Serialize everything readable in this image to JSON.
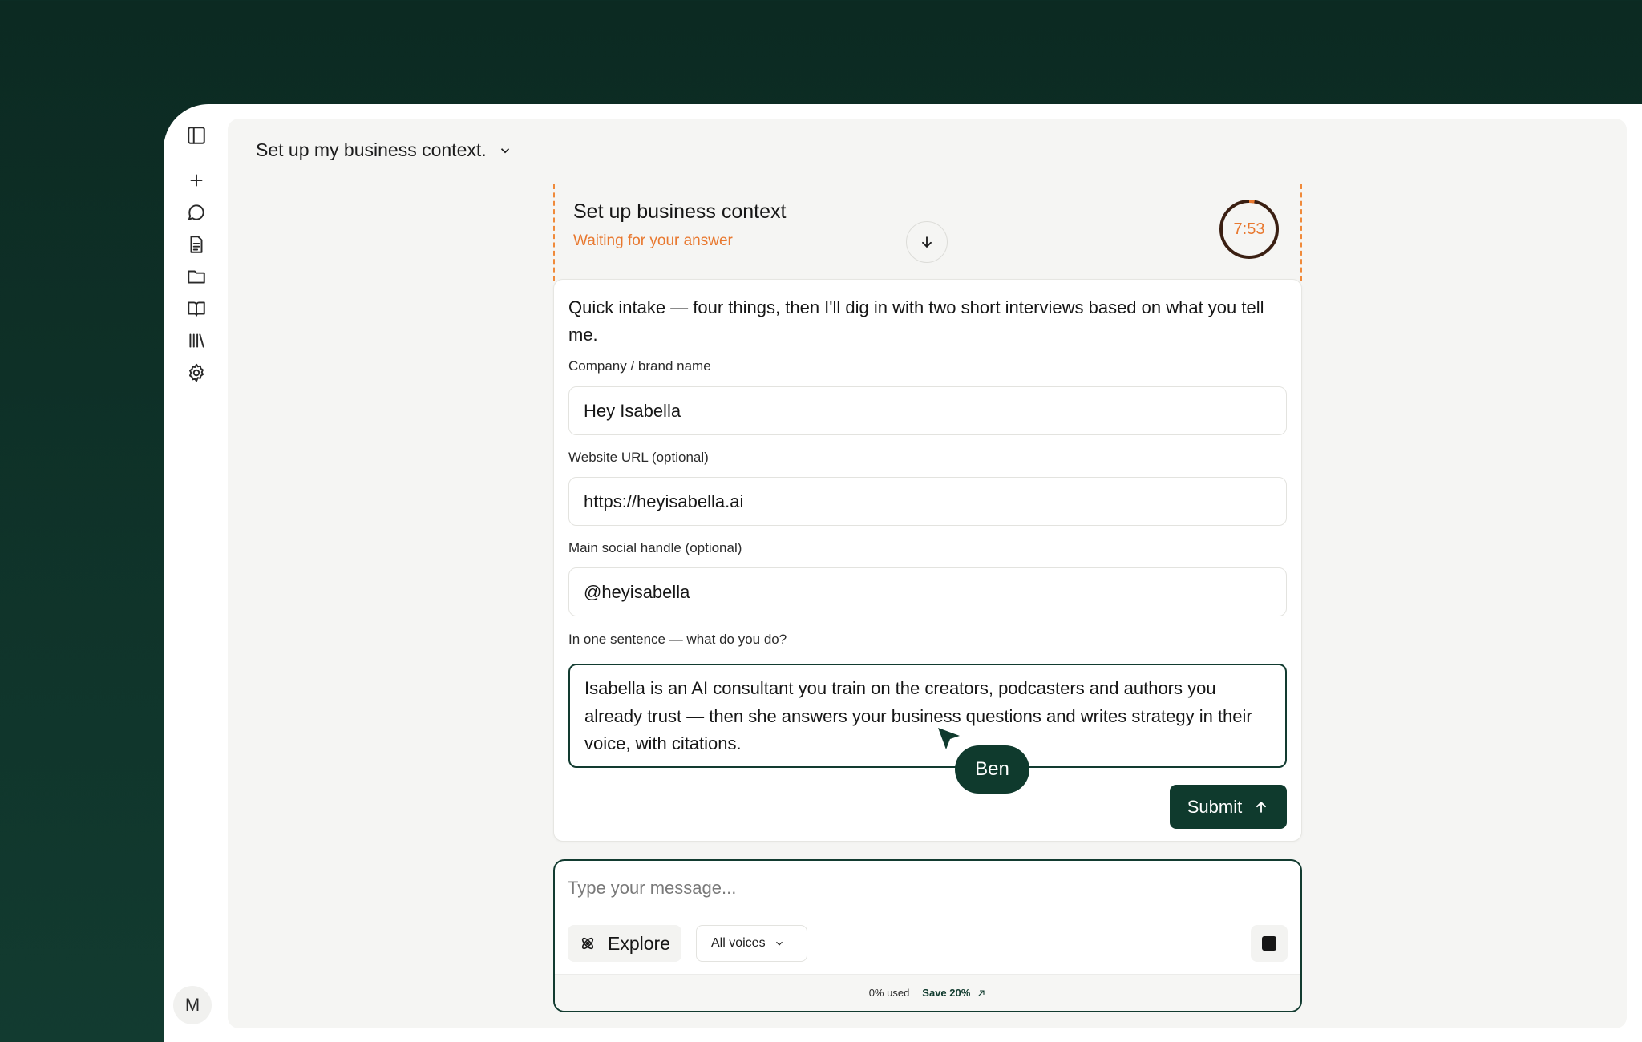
{
  "header": {
    "chat_title": "Set up my business context."
  },
  "task": {
    "title": "Set up business context",
    "status": "Waiting for your answer",
    "timer": "7:53",
    "timer_progress": 0.03,
    "status_color": "#e8782f"
  },
  "form": {
    "intro": "Quick intake — four things, then I'll dig in with two short interviews based on what you tell me.",
    "fields": [
      {
        "label": "Company / brand name",
        "value": "Hey Isabella"
      },
      {
        "label": "Website URL (optional)",
        "value": "https://heyisabella.ai"
      },
      {
        "label": "Main social handle (optional)",
        "value": "@heyisabella"
      },
      {
        "label": "In one sentence — what do you do?",
        "value": "Isabella is an AI consultant you train on the creators, podcasters and authors you already trust — then she answers your business questions and writes strategy in their voice, with citations."
      }
    ],
    "submit_label": "Submit"
  },
  "cursor": {
    "name": "Ben"
  },
  "composer": {
    "placeholder": "Type your message...",
    "explore_label": "Explore",
    "voices_label": "All voices",
    "usage_text": "0% used",
    "save_label": "Save 20%"
  },
  "sidebar": {
    "icons": [
      "sidebar-toggle-icon",
      "plus-icon",
      "chat-icon",
      "document-icon",
      "folder-icon",
      "book-icon",
      "library-icon",
      "gear-icon"
    ]
  },
  "user": {
    "avatar_initial": "M"
  },
  "colors": {
    "brand": "#0f3a2d",
    "accent": "#e8782f",
    "background": "#123b30"
  }
}
